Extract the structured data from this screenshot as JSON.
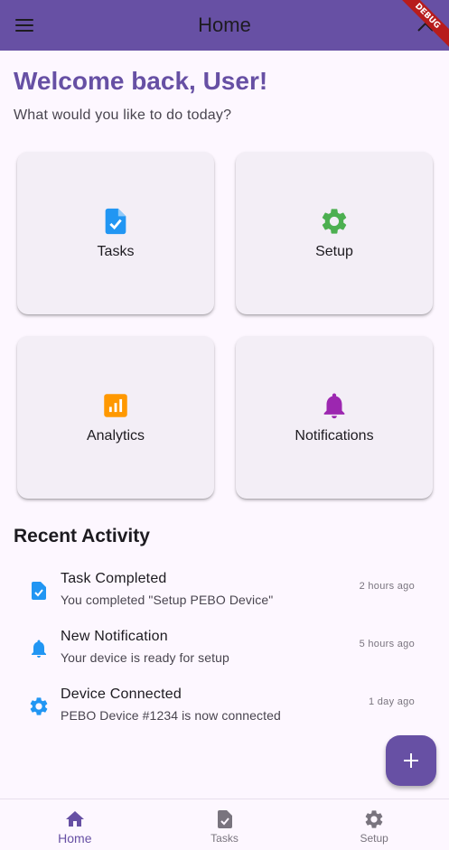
{
  "appbar": {
    "title": "Home",
    "debug_banner": "DEBUG",
    "menu_icon": "hamburger-menu-icon",
    "background": "#6750a4"
  },
  "header": {
    "welcome": "Welcome back, User!",
    "subtitle": "What would you like to do today?"
  },
  "cards": [
    {
      "label": "Tasks",
      "icon": "task-document-icon",
      "color": "#2196f3"
    },
    {
      "label": "Setup",
      "icon": "gear-icon",
      "color": "#4caf50"
    },
    {
      "label": "Analytics",
      "icon": "analytics-chart-icon",
      "color": "#ff9800"
    },
    {
      "label": "Notifications",
      "icon": "bell-icon",
      "color": "#9c27b0"
    }
  ],
  "recent": {
    "title": "Recent Activity",
    "items": [
      {
        "title": "Task Completed",
        "subtitle": "You completed \"Setup PEBO Device\"",
        "time": "2 hours ago",
        "icon": "task-document-icon"
      },
      {
        "title": "New Notification",
        "subtitle": "Your device is ready for setup",
        "time": "5 hours ago",
        "icon": "bell-icon"
      },
      {
        "title": "Device Connected",
        "subtitle": "PEBO Device #1234 is now connected",
        "time": "1 day ago",
        "icon": "gear-icon"
      }
    ]
  },
  "fab": {
    "icon": "plus-icon"
  },
  "bottom_nav": {
    "items": [
      {
        "label": "Home",
        "icon": "home-icon",
        "active": true
      },
      {
        "label": "Tasks",
        "icon": "task-document-icon",
        "active": false
      },
      {
        "label": "Setup",
        "icon": "gear-icon",
        "active": false
      }
    ]
  }
}
